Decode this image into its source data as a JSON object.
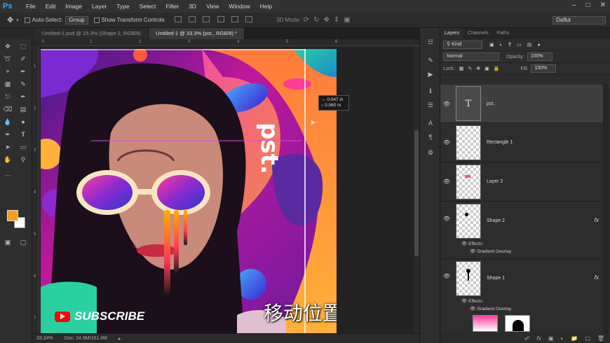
{
  "app": {
    "logo": "Ps"
  },
  "menu": [
    "File",
    "Edit",
    "Image",
    "Layer",
    "Type",
    "Select",
    "Filter",
    "3D",
    "View",
    "Window",
    "Help"
  ],
  "options_bar": {
    "auto_select_label": "Auto-Select:",
    "auto_select_value": "Group",
    "show_transform_label": "Show Transform Controls",
    "mode_label": "3D Mode:",
    "workspace_value": "Daflut"
  },
  "tabs": [
    {
      "label": "Untitled-1.psd @ 15.3% (Shape 2, RGB/8)",
      "active": false
    },
    {
      "label": "Untitled-1 @ 33.3% (pst., RGB/8) *",
      "active": true
    }
  ],
  "rulers": {
    "top": [
      "0",
      "1",
      "2",
      "3",
      "4",
      "5",
      "6"
    ],
    "left": [
      "1",
      "2",
      "3",
      "4",
      "5",
      "6",
      "7"
    ]
  },
  "canvas": {
    "vertical_text": "pst.",
    "subscribe_label": "SUBSCRIBE",
    "caption": "移动位置",
    "tooltip_dx": "0.047 in",
    "tooltip_dy": "0.060 in"
  },
  "status": {
    "zoom": "33.34%",
    "doc": "Doc: 24.9M/161.4M"
  },
  "panel": {
    "tabs": [
      "Layers",
      "Channels",
      "Paths"
    ],
    "filter_kind": "Kind",
    "blend_mode": "Normal",
    "opacity_label": "Opacity:",
    "opacity_value": "100%",
    "lock_label": "Lock:",
    "fill_label": "Fill:",
    "fill_value": "100%",
    "layers": [
      {
        "name": "pst.",
        "type": "text",
        "thumb_glyph": "T"
      },
      {
        "name": "Rectangle 1",
        "type": "shape"
      },
      {
        "name": "Layer 2",
        "type": "pixel"
      },
      {
        "name": "Shape 2",
        "type": "shape",
        "fx": "fx",
        "effects_label": "Effects",
        "effect": "Gradient Overlay"
      },
      {
        "name": "Shape 1",
        "type": "shape",
        "fx": "fx",
        "effects_label": "Effects",
        "effect": "Gradient Overlay"
      }
    ]
  },
  "colors": {
    "foreground": "#f5a01a",
    "background": "#ffffff",
    "accent": "#31a8ff"
  }
}
